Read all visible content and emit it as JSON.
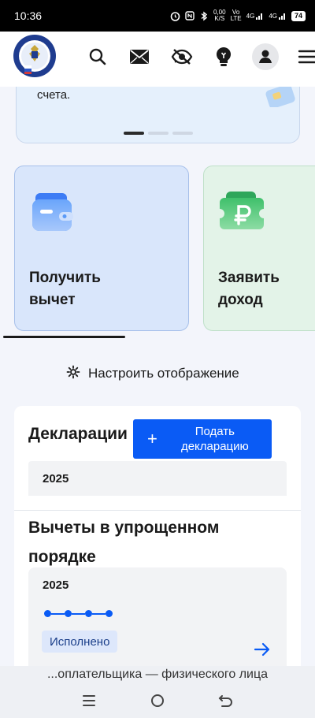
{
  "status_bar": {
    "time": "10:36",
    "speed_top": "0,00",
    "speed_bottom": "K/S",
    "volte_top": "Vo",
    "volte_bottom": "LTE",
    "net1": "4G",
    "net2": "4G",
    "battery": "74"
  },
  "header": {
    "icons": [
      "search-icon",
      "mail-icon",
      "eye-off-icon",
      "bulb-icon",
      "profile-icon",
      "menu-icon"
    ]
  },
  "carousel": {
    "text": "счета.",
    "page_count": 3,
    "active_page": 1
  },
  "tiles": [
    {
      "label_line1": "Получить",
      "label_line2": "вычет",
      "icon": "wallet-icon"
    },
    {
      "label_line1": "Заявить",
      "label_line2": "доход",
      "icon": "ruble-ticket-icon"
    }
  ],
  "customize": {
    "label": "Настроить отображение",
    "icon": "gear-icon"
  },
  "declarations": {
    "title": "Декларации",
    "submit_label_line1": "Подать",
    "submit_label_line2": "декларацию",
    "year": "2025"
  },
  "simplified_deductions": {
    "title": "Вычеты в упрощенном порядке",
    "year": "2025",
    "steps_completed": 4,
    "steps_total": 4,
    "status": "Исполнено"
  },
  "footer": {
    "caption": "...оплательщика — физического лица"
  },
  "colors": {
    "accent": "#0a5bf5",
    "tile_blue": "#d9e6fb",
    "tile_green": "#e3f3e8",
    "status_badge_bg": "#dde7fb"
  }
}
